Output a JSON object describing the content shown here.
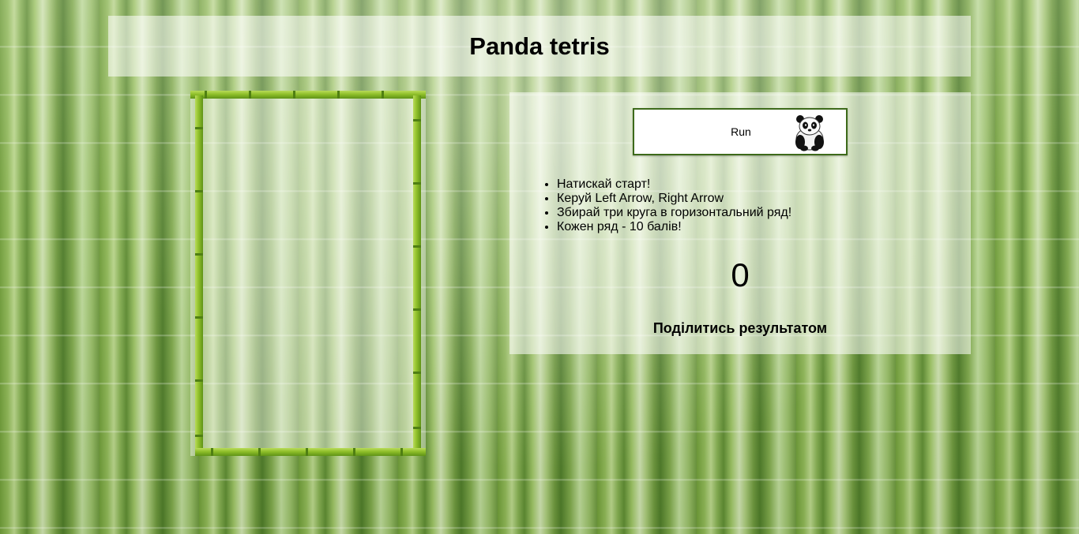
{
  "header": {
    "title": "Panda tetris"
  },
  "controls": {
    "run_label": "Run",
    "run_icon": "panda-icon"
  },
  "rules": [
    "Натискай старт!",
    "Керуй Left Arrow, Right Arrow",
    "Збирай три круга в горизонтальний ряд!",
    "Кожен ряд - 10 балів!"
  ],
  "score": "0",
  "share_label": "Поділитись результатом",
  "colors": {
    "frame_bamboo": "#8fbf2a",
    "button_border": "#3d6a1a",
    "panel_overlay": "rgba(255,255,255,0.55)"
  }
}
